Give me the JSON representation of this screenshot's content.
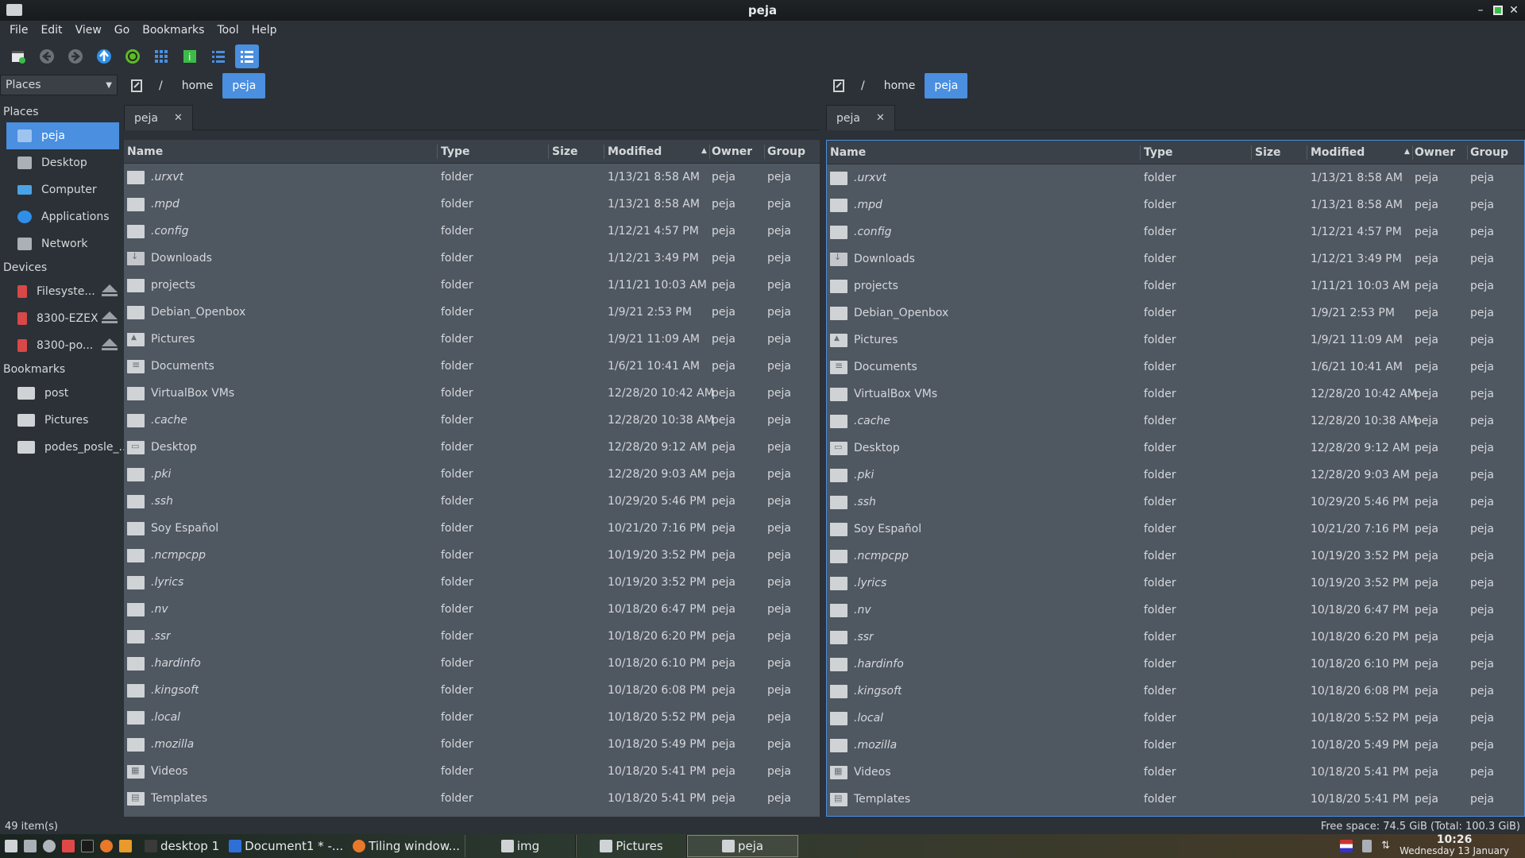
{
  "window": {
    "title": "peja"
  },
  "menu": [
    "File",
    "Edit",
    "View",
    "Go",
    "Bookmarks",
    "Tool",
    "Help"
  ],
  "toolbar": {
    "icons": [
      "new-window-icon",
      "back-icon",
      "forward-icon",
      "up-icon",
      "reload-icon",
      "icon-view-icon",
      "info-icon",
      "detailed-list-icon",
      "compact-list-icon"
    ]
  },
  "places_combo": "Places",
  "sidebar": {
    "places_title": "Places",
    "places": [
      {
        "label": "peja",
        "icon": "home-icon"
      },
      {
        "label": "Desktop",
        "icon": "desktop-icon"
      },
      {
        "label": "Computer",
        "icon": "computer-icon"
      },
      {
        "label": "Applications",
        "icon": "applications-icon"
      },
      {
        "label": "Network",
        "icon": "network-icon"
      }
    ],
    "devices_title": "Devices",
    "devices": [
      {
        "label": "Filesyste..."
      },
      {
        "label": "8300-EZEX"
      },
      {
        "label": "8300-po..."
      }
    ],
    "bookmarks_title": "Bookmarks",
    "bookmarks": [
      {
        "label": "post"
      },
      {
        "label": "Pictures"
      },
      {
        "label": "podes_posle_..."
      }
    ]
  },
  "left": {
    "crumbs": [
      "/",
      "home",
      "peja"
    ],
    "tab": "peja"
  },
  "right": {
    "crumbs": [
      "/",
      "home",
      "peja"
    ],
    "tab": "peja"
  },
  "columns": {
    "name": "Name",
    "type": "Type",
    "size": "Size",
    "modified": "Modified",
    "owner": "Owner",
    "group": "Group"
  },
  "files": [
    {
      "name": ".urxvt",
      "type": "folder",
      "modified": "1/13/21 8:58 AM",
      "owner": "peja",
      "group": "peja",
      "hidden": true,
      "icon": "folder"
    },
    {
      "name": ".mpd",
      "type": "folder",
      "modified": "1/13/21 8:58 AM",
      "owner": "peja",
      "group": "peja",
      "hidden": true,
      "icon": "folder"
    },
    {
      "name": ".config",
      "type": "folder",
      "modified": "1/12/21 4:57 PM",
      "owner": "peja",
      "group": "peja",
      "hidden": true,
      "icon": "folder"
    },
    {
      "name": "Downloads",
      "type": "folder",
      "modified": "1/12/21 3:49 PM",
      "owner": "peja",
      "group": "peja",
      "hidden": false,
      "icon": "dl"
    },
    {
      "name": "projects",
      "type": "folder",
      "modified": "1/11/21 10:03 AM",
      "owner": "peja",
      "group": "peja",
      "hidden": false,
      "icon": "folder"
    },
    {
      "name": "Debian_Openbox",
      "type": "folder",
      "modified": "1/9/21 2:53 PM",
      "owner": "peja",
      "group": "peja",
      "hidden": false,
      "icon": "folder"
    },
    {
      "name": "Pictures",
      "type": "folder",
      "modified": "1/9/21 11:09 AM",
      "owner": "peja",
      "group": "peja",
      "hidden": false,
      "icon": "pic"
    },
    {
      "name": "Documents",
      "type": "folder",
      "modified": "1/6/21 10:41 AM",
      "owner": "peja",
      "group": "peja",
      "hidden": false,
      "icon": "doc"
    },
    {
      "name": "VirtualBox VMs",
      "type": "folder",
      "modified": "12/28/20 10:42 AM",
      "owner": "peja",
      "group": "peja",
      "hidden": false,
      "icon": "folder"
    },
    {
      "name": ".cache",
      "type": "folder",
      "modified": "12/28/20 10:38 AM",
      "owner": "peja",
      "group": "peja",
      "hidden": true,
      "icon": "folder"
    },
    {
      "name": "Desktop",
      "type": "folder",
      "modified": "12/28/20 9:12 AM",
      "owner": "peja",
      "group": "peja",
      "hidden": false,
      "icon": "desk"
    },
    {
      "name": ".pki",
      "type": "folder",
      "modified": "12/28/20 9:03 AM",
      "owner": "peja",
      "group": "peja",
      "hidden": true,
      "icon": "folder"
    },
    {
      "name": ".ssh",
      "type": "folder",
      "modified": "10/29/20 5:46 PM",
      "owner": "peja",
      "group": "peja",
      "hidden": true,
      "icon": "folder"
    },
    {
      "name": "Soy Español",
      "type": "folder",
      "modified": "10/21/20 7:16 PM",
      "owner": "peja",
      "group": "peja",
      "hidden": false,
      "icon": "folder"
    },
    {
      "name": ".ncmpcpp",
      "type": "folder",
      "modified": "10/19/20 3:52 PM",
      "owner": "peja",
      "group": "peja",
      "hidden": true,
      "icon": "folder"
    },
    {
      "name": ".lyrics",
      "type": "folder",
      "modified": "10/19/20 3:52 PM",
      "owner": "peja",
      "group": "peja",
      "hidden": true,
      "icon": "folder"
    },
    {
      "name": ".nv",
      "type": "folder",
      "modified": "10/18/20 6:47 PM",
      "owner": "peja",
      "group": "peja",
      "hidden": true,
      "icon": "folder"
    },
    {
      "name": ".ssr",
      "type": "folder",
      "modified": "10/18/20 6:20 PM",
      "owner": "peja",
      "group": "peja",
      "hidden": true,
      "icon": "folder"
    },
    {
      "name": ".hardinfo",
      "type": "folder",
      "modified": "10/18/20 6:10 PM",
      "owner": "peja",
      "group": "peja",
      "hidden": true,
      "icon": "folder"
    },
    {
      "name": ".kingsoft",
      "type": "folder",
      "modified": "10/18/20 6:08 PM",
      "owner": "peja",
      "group": "peja",
      "hidden": true,
      "icon": "folder"
    },
    {
      "name": ".local",
      "type": "folder",
      "modified": "10/18/20 5:52 PM",
      "owner": "peja",
      "group": "peja",
      "hidden": true,
      "icon": "folder"
    },
    {
      "name": ".mozilla",
      "type": "folder",
      "modified": "10/18/20 5:49 PM",
      "owner": "peja",
      "group": "peja",
      "hidden": true,
      "icon": "folder"
    },
    {
      "name": "Videos",
      "type": "folder",
      "modified": "10/18/20 5:41 PM",
      "owner": "peja",
      "group": "peja",
      "hidden": false,
      "icon": "vid"
    },
    {
      "name": "Templates",
      "type": "folder",
      "modified": "10/18/20 5:41 PM",
      "owner": "peja",
      "group": "peja",
      "hidden": false,
      "icon": "tpl"
    }
  ],
  "status": {
    "items": "49 item(s)",
    "free": "Free space: 74.5 GiB (Total: 100.3 GiB)"
  },
  "taskbar": {
    "tasks": [
      "desktop 1",
      "Document1 * -...",
      "Tiling window...",
      "img",
      "Pictures",
      "peja"
    ],
    "time": "10:26",
    "date": "Wednesday 13 January"
  },
  "colors": {
    "accent": "#4a8fe0",
    "list_bg": "#4f5761",
    "window_bg": "#2b3136"
  }
}
